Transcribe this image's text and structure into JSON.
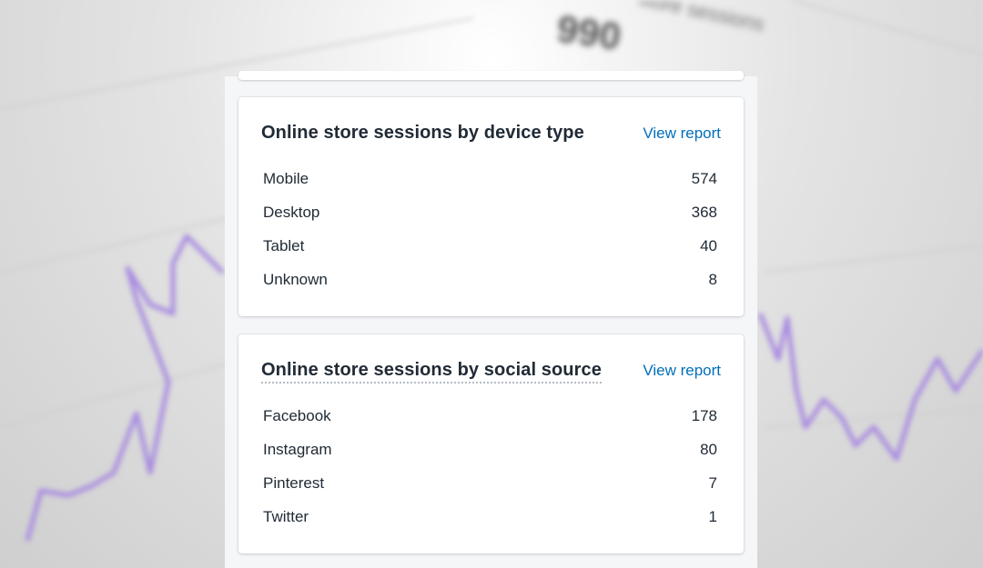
{
  "background": {
    "value": "990",
    "caption": "store sessions"
  },
  "cards": [
    {
      "title": "Online store sessions by device type",
      "link": "View report",
      "rows": [
        {
          "label": "Mobile",
          "value": "574"
        },
        {
          "label": "Desktop",
          "value": "368"
        },
        {
          "label": "Tablet",
          "value": "40"
        },
        {
          "label": "Unknown",
          "value": "8"
        }
      ]
    },
    {
      "title": "Online store sessions by social source",
      "link": "View report",
      "rows": [
        {
          "label": "Facebook",
          "value": "178"
        },
        {
          "label": "Instagram",
          "value": "80"
        },
        {
          "label": "Pinterest",
          "value": "7"
        },
        {
          "label": "Twitter",
          "value": "1"
        }
      ]
    }
  ],
  "colors": {
    "link": "#006fbb",
    "text": "#212b36",
    "line": "#9a7fd6"
  }
}
